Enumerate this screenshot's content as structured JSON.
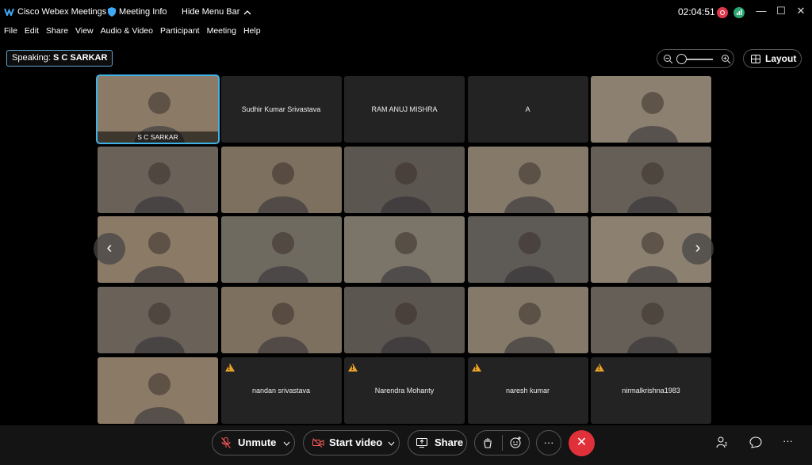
{
  "titlebar": {
    "app_name": "Cisco Webex Meetings",
    "meeting_info": "Meeting Info",
    "hide_menu": "Hide Menu Bar",
    "clock": "02:04:51"
  },
  "menu": [
    "File",
    "Edit",
    "Share",
    "View",
    "Audio & Video",
    "Participant",
    "Meeting",
    "Help"
  ],
  "speaking": {
    "label": "Speaking:",
    "name": "S C SARKAR"
  },
  "layout_button": "Layout",
  "tiles": [
    {
      "name": "S C SARKAR",
      "type": "video",
      "caption": "S C SARKAR",
      "selected": true
    },
    {
      "name": "Sudhir Kumar Srivastava",
      "type": "name"
    },
    {
      "name": "RAM ANUJ MISHRA",
      "type": "name"
    },
    {
      "name": "A",
      "type": "name"
    },
    {
      "type": "video"
    },
    {
      "type": "video"
    },
    {
      "type": "video"
    },
    {
      "type": "video"
    },
    {
      "type": "video"
    },
    {
      "type": "video"
    },
    {
      "type": "video"
    },
    {
      "type": "video"
    },
    {
      "type": "video"
    },
    {
      "type": "video"
    },
    {
      "type": "video"
    },
    {
      "type": "video"
    },
    {
      "type": "video"
    },
    {
      "type": "video"
    },
    {
      "type": "video"
    },
    {
      "type": "video"
    },
    {
      "type": "video"
    },
    {
      "name": "nandan srivastava",
      "type": "name",
      "warning": true
    },
    {
      "name": "Narendra Mohanty",
      "type": "name",
      "warning": true
    },
    {
      "name": "naresh kumar",
      "type": "name",
      "warning": true
    },
    {
      "name": "nirmalkrishna1983",
      "type": "name",
      "warning": true
    }
  ],
  "controls": {
    "unmute": "Unmute",
    "start_video": "Start video",
    "share": "Share",
    "more": "···",
    "end": "✕"
  },
  "colors": {
    "accent": "#3fb2e6",
    "end": "#e0303a",
    "warning": "#e8a227",
    "record": "#e0384b",
    "network": "#2aa772"
  }
}
